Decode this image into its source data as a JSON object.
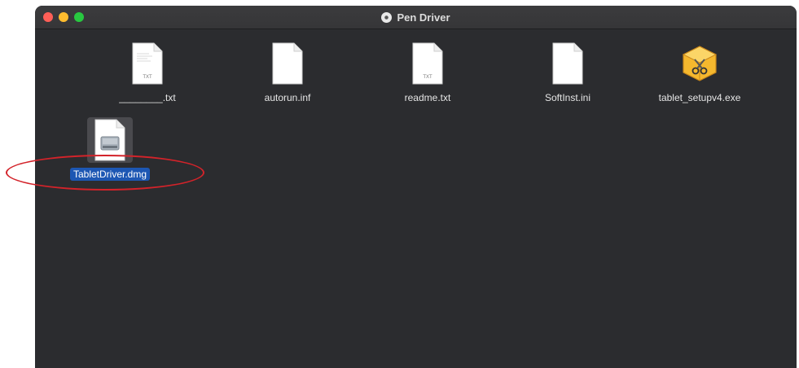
{
  "window": {
    "title": "Pen Driver",
    "title_icon": "disk-icon"
  },
  "files": [
    {
      "name": "________.txt",
      "icon": "text-document-icon",
      "badge": "TXT"
    },
    {
      "name": "autorun.inf",
      "icon": "blank-document-icon",
      "badge": ""
    },
    {
      "name": "readme.txt",
      "icon": "text-document-icon",
      "badge": "TXT"
    },
    {
      "name": "SoftInst.ini",
      "icon": "blank-document-icon",
      "badge": ""
    },
    {
      "name": "tablet_setupv4.exe",
      "icon": "exe-archive-icon",
      "badge": ""
    },
    {
      "name": "TabletDriver.dmg",
      "icon": "disk-image-icon",
      "badge": "",
      "selected": true
    }
  ],
  "annotation": {
    "color": "#d3232a",
    "shape": "ellipse-around-selected-file"
  }
}
